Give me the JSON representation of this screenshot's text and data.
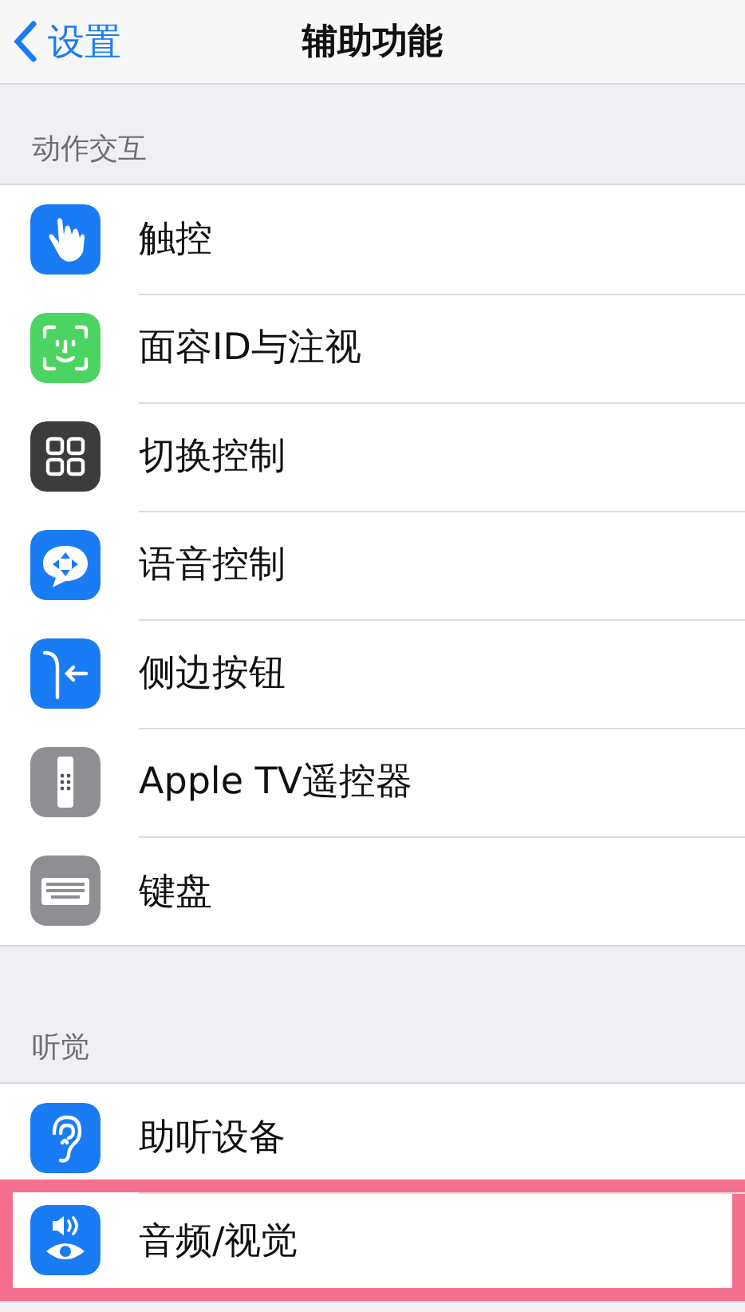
{
  "nav": {
    "back": "设置",
    "title": "辅助功能"
  },
  "sections": [
    {
      "header": "动作交互",
      "items": [
        {
          "label": "触控",
          "kind": "hand",
          "color": "#1a7cf5",
          "highlighted": false
        },
        {
          "label": "面容ID与注视",
          "kind": "face",
          "color": "#4cd463",
          "highlighted": false
        },
        {
          "label": "切换控制",
          "kind": "grid",
          "color": "#3c3c3e",
          "highlighted": false
        },
        {
          "label": "语音控制",
          "kind": "speech",
          "color": "#1a7cf5",
          "highlighted": false
        },
        {
          "label": "侧边按钮",
          "kind": "side",
          "color": "#1a7cf5",
          "highlighted": false
        },
        {
          "label": "Apple TV遥控器",
          "kind": "remote",
          "color": "#8e8e93",
          "highlighted": false
        },
        {
          "label": "键盘",
          "kind": "keyboard",
          "color": "#8e8e93",
          "highlighted": false
        }
      ]
    },
    {
      "header": "听觉",
      "items": [
        {
          "label": "助听设备",
          "kind": "ear",
          "color": "#1a7cf5",
          "highlighted": false
        },
        {
          "label": "音频/视觉",
          "kind": "av",
          "color": "#1a7cf5",
          "highlighted": true
        }
      ]
    }
  ]
}
